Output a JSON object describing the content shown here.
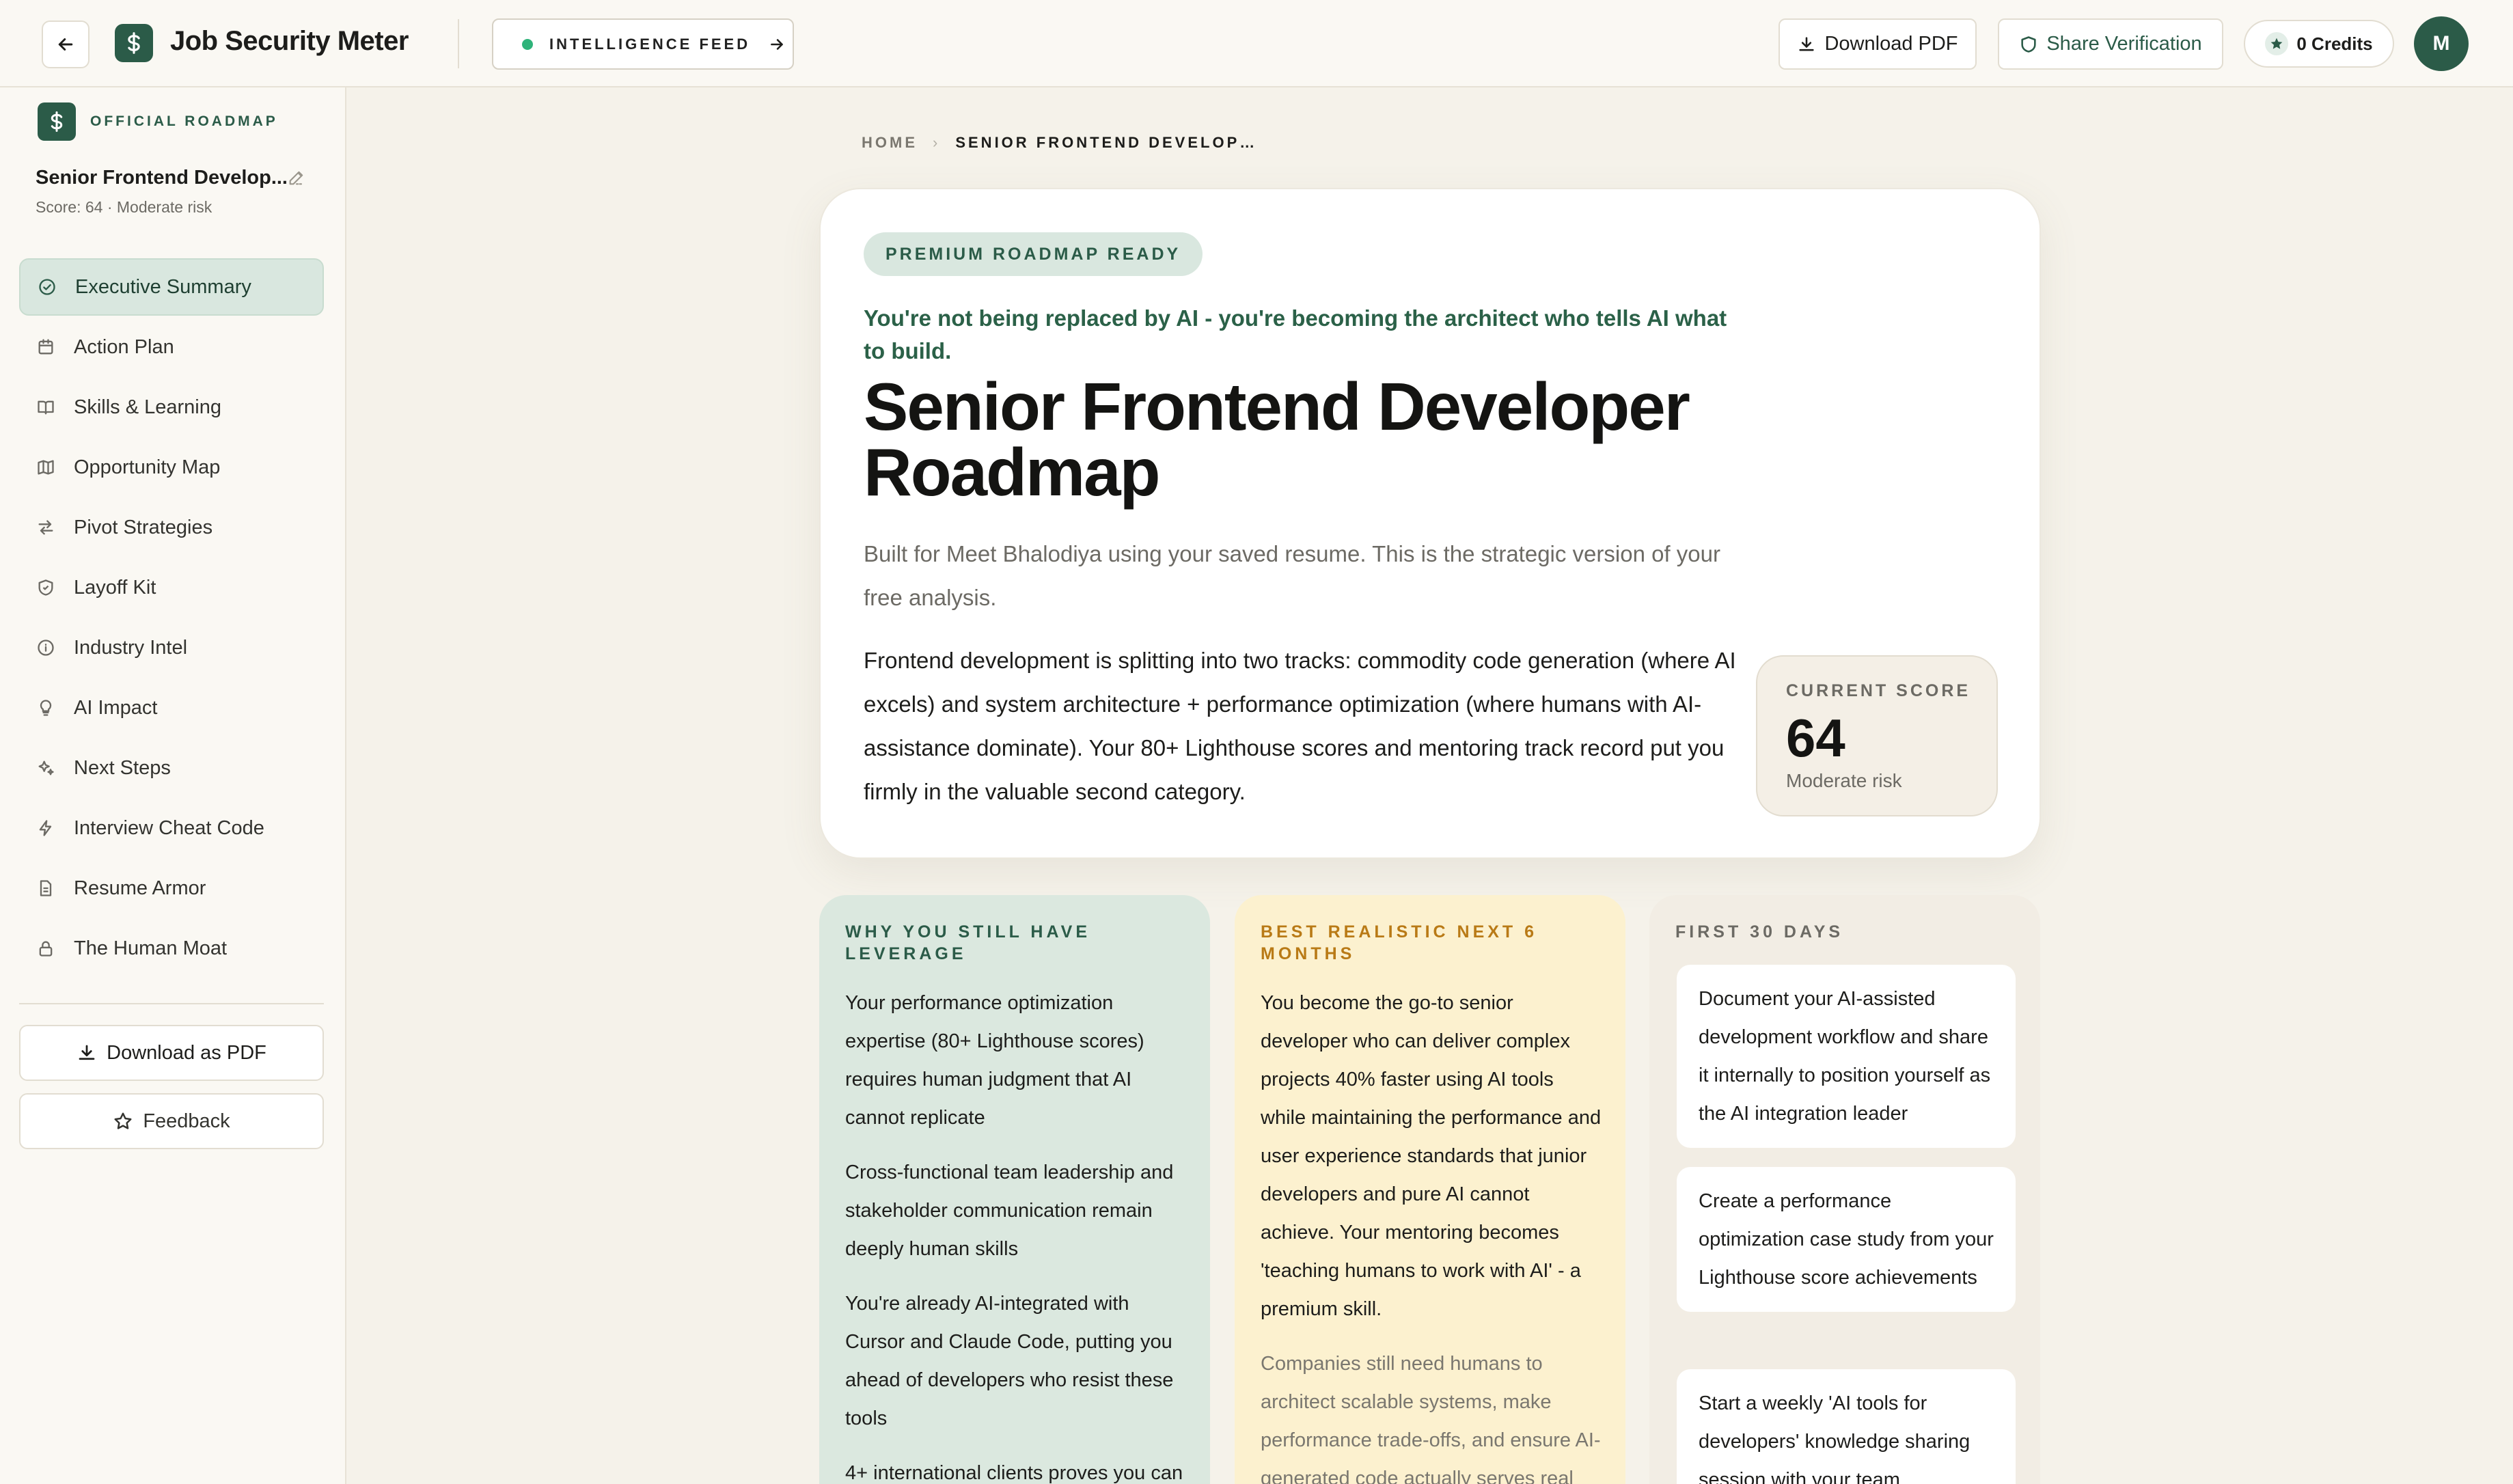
{
  "header": {
    "app_title": "Job Security Meter",
    "feed_label": "INTELLIGENCE FEED",
    "download_pdf": "Download PDF",
    "share_verification": "Share Verification",
    "credits": "0 Credits",
    "avatar_initial": "M"
  },
  "sidebar": {
    "official_label": "OFFICIAL ROADMAP",
    "roadmap_title": "Senior Frontend Develop...",
    "score_line": "Score: 64 · Moderate risk",
    "items": [
      {
        "label": "Executive Summary",
        "icon": "check-circle-icon"
      },
      {
        "label": "Action Plan",
        "icon": "calendar-icon"
      },
      {
        "label": "Skills & Learning",
        "icon": "book-icon"
      },
      {
        "label": "Opportunity Map",
        "icon": "map-icon"
      },
      {
        "label": "Pivot Strategies",
        "icon": "arrows-icon"
      },
      {
        "label": "Layoff Kit",
        "icon": "shield-icon"
      },
      {
        "label": "Industry Intel",
        "icon": "info-icon"
      },
      {
        "label": "AI Impact",
        "icon": "lightbulb-icon"
      },
      {
        "label": "Next Steps",
        "icon": "sparkles-icon"
      },
      {
        "label": "Interview Cheat Code",
        "icon": "bolt-icon"
      },
      {
        "label": "Resume Armor",
        "icon": "document-icon"
      },
      {
        "label": "The Human Moat",
        "icon": "lock-icon"
      }
    ],
    "download_pdf": "Download as PDF",
    "feedback": "Feedback"
  },
  "breadcrumb": {
    "home": "HOME",
    "current": "SENIOR FRONTEND DEVELOP…"
  },
  "hero": {
    "pill": "PREMIUM ROADMAP READY",
    "tagline": "You're not being replaced by AI - you're becoming the architect who tells AI what to build.",
    "title": "Senior Frontend Developer Roadmap",
    "subtitle": "Built for Meet Bhalodiya using your saved resume. This is the strategic version of your free analysis.",
    "body": "Frontend development is splitting into two tracks: commodity code generation (where AI excels) and system architecture + performance optimization (where humans with AI-assistance dominate). Your 80+ Lighthouse scores and mentoring track record put you firmly in the valuable second category.",
    "score_label": "CURRENT SCORE",
    "score_value": "64",
    "score_risk": "Moderate risk"
  },
  "leverage": {
    "heading": "WHY YOU STILL HAVE LEVERAGE",
    "points": [
      "Your performance optimization expertise (80+ Lighthouse scores) requires human judgment that AI cannot replicate",
      "Cross-functional team leadership and stakeholder communication remain deeply human skills",
      "You're already AI-integrated with Cursor and Claude Code, putting you ahead of developers who resist these tools",
      "4+ international clients proves you can"
    ]
  },
  "next_six_months": {
    "heading": "BEST REALISTIC NEXT 6 MONTHS",
    "body": "You become the go-to senior developer who can deliver complex projects 40% faster using AI tools while maintaining the performance and user experience standards that junior developers and pure AI cannot achieve. Your mentoring becomes 'teaching humans to work with AI' - a premium skill.",
    "note": "Companies still need humans to architect scalable systems, make performance trade-offs, and ensure AI-generated code actually serves real"
  },
  "first_30_days": {
    "heading": "FIRST 30 DAYS",
    "tasks": [
      "Document your AI-assisted development workflow and share it internally to position yourself as the AI integration leader",
      "Create a performance optimization case study from your Lighthouse score achievements",
      "Start a weekly 'AI tools for developers' knowledge sharing session with your team"
    ]
  }
}
